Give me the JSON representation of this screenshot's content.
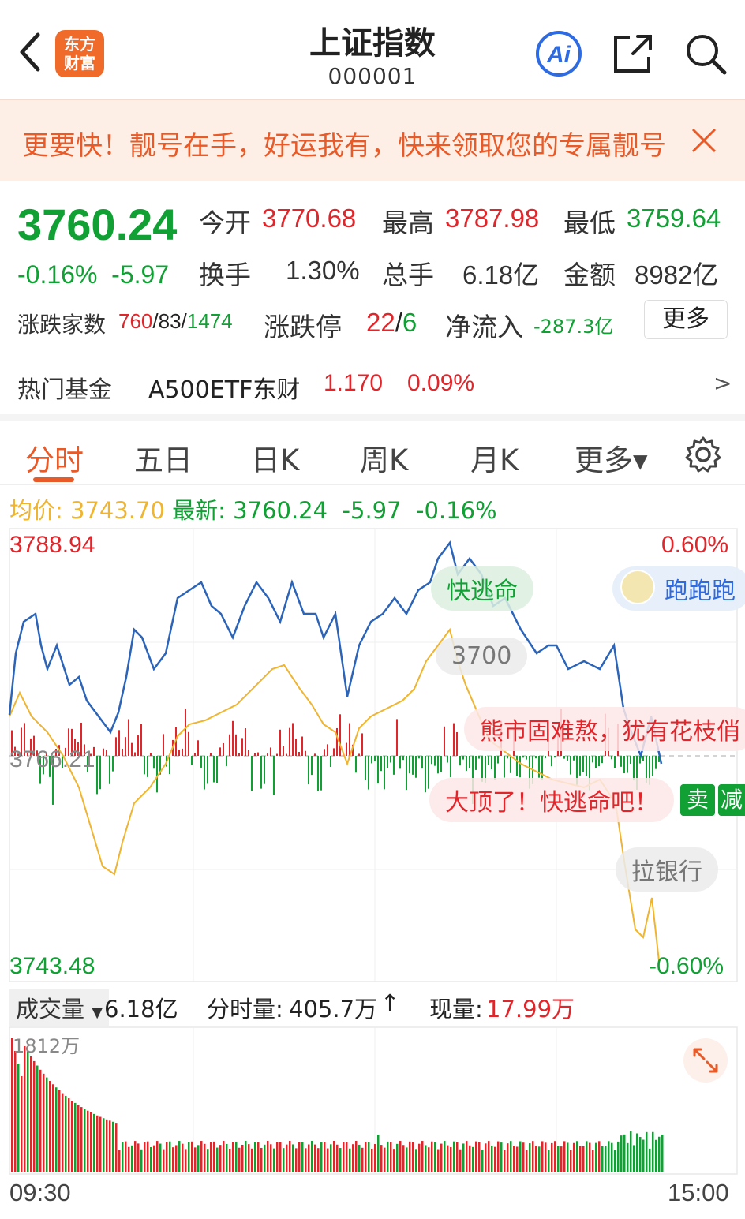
{
  "header": {
    "title": "上证指数",
    "code": "000001",
    "logo_line1": "东方",
    "logo_line2": "财富",
    "ai_label": "Ai"
  },
  "banner": {
    "text": "更要快！靓号在手，好运我有，快来领取您的专属靓号"
  },
  "quote": {
    "price": "3760.24",
    "change_pct": "-0.16%",
    "change": "-5.97",
    "open_label": "今开",
    "open": "3770.68",
    "high_label": "最高",
    "high": "3787.98",
    "low_label": "最低",
    "low": "3759.64",
    "turnover_label": "换手",
    "turnover": "1.30%",
    "volume_label": "总手",
    "volume": "6.18亿",
    "amount_label": "金额",
    "amount": "8982亿",
    "breadth_label": "涨跌家数",
    "breadth_up": "760",
    "breadth_flat": "83",
    "breadth_down": "1474",
    "sep": "/",
    "limit_label": "涨跌停",
    "limit_up": "22",
    "limit_down": "6",
    "netflow_label": "净流入",
    "netflow": "-287.3亿",
    "more_label": "更多"
  },
  "fund": {
    "label": "热门基金",
    "name": "A500ETF东财",
    "price": "1.170",
    "pct": "0.09%",
    "arrow": ">"
  },
  "tabs": [
    {
      "label": "分时",
      "active": true
    },
    {
      "label": "五日"
    },
    {
      "label": "日K"
    },
    {
      "label": "周K"
    },
    {
      "label": "月K"
    },
    {
      "label": "更多▾"
    }
  ],
  "info_line": {
    "avg_label": "均价:",
    "avg": "3743.70",
    "last_label": "最新:",
    "last": "3760.24",
    "chg": "-5.97",
    "pct": "-0.16%"
  },
  "chart_axis": {
    "top_price": "3788.94",
    "mid_price": "3766.21",
    "bottom_price": "3743.48",
    "top_pct": "0.60%",
    "bottom_pct": "-0.60%"
  },
  "bubbles": {
    "b1": "快逃命",
    "b2": "跑跑跑",
    "b3": "3700",
    "b4": "熊市固难熬，犹有花枝俏",
    "b5": "大顶了！快逃命吧！",
    "b6": "拉银行",
    "sell_label": "卖",
    "reduce_label": "减"
  },
  "volume": {
    "label": "成交量",
    "total": "6.18亿",
    "minute_label": "分时量:",
    "minute": "405.7万",
    "arrow": "↑",
    "now_label": "现量:",
    "now": "17.99万",
    "max_label": "1812万"
  },
  "time_axis": {
    "start": "09:30",
    "end": "15:00"
  },
  "colors": {
    "up": "#e0262b",
    "down": "#11a034",
    "price_line": "#2b64b8",
    "avg_line": "#f0b530",
    "accent": "#e85a28"
  },
  "icons": [
    "back-icon",
    "ai-icon",
    "share-icon",
    "search-icon",
    "close-icon",
    "gear-icon",
    "expand-icon"
  ]
}
